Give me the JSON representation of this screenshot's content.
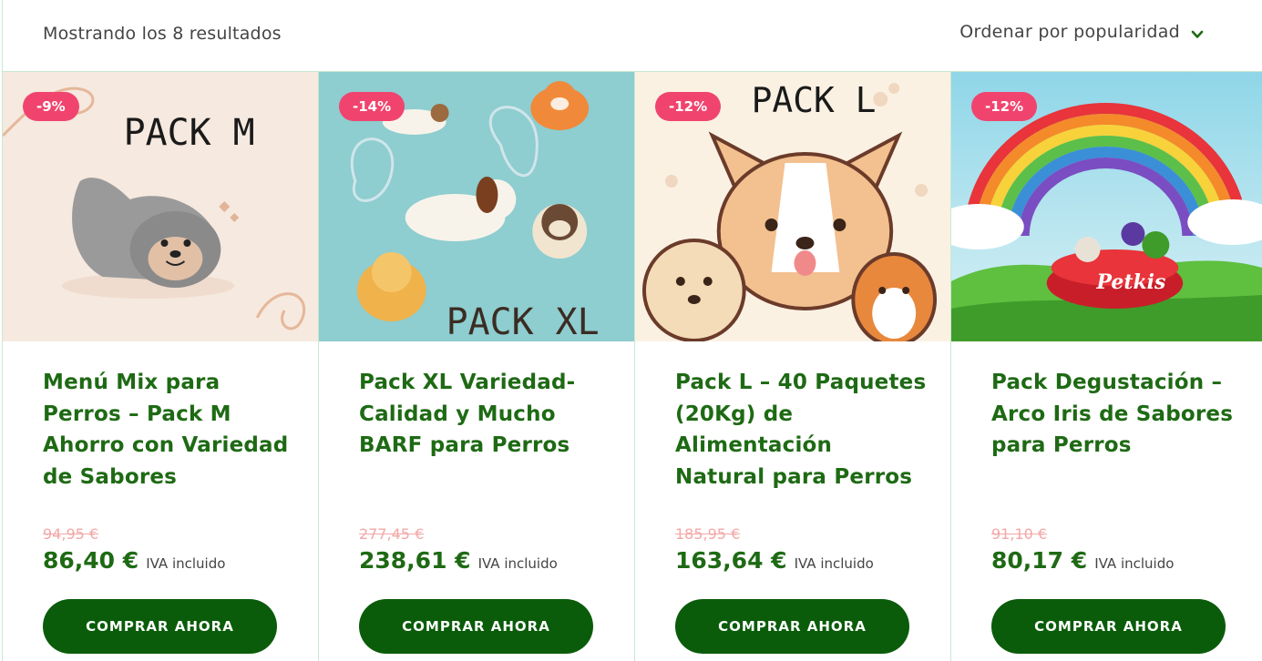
{
  "toolbar": {
    "results_text": "Mostrando los 8 resultados",
    "sort_label": "Ordenar por popularidad"
  },
  "products": [
    {
      "badge": "-9%",
      "image_text": "PACK M",
      "title": "Menú Mix para Perros – Pack M Ahorro con Variedad de Sabores",
      "old_price": "94,95 €",
      "price": "86,40 €",
      "vat": "IVA incluido",
      "button": "COMPRAR AHORA"
    },
    {
      "badge": "-14%",
      "image_text": "PACK XL",
      "title": "Pack XL Variedad- Calidad y Mucho BARF para Perros",
      "old_price": "277,45 €",
      "price": "238,61 €",
      "vat": "IVA incluido",
      "button": "COMPRAR AHORA"
    },
    {
      "badge": "-12%",
      "image_text": "PACK L",
      "title": "Pack L – 40 Paquetes (20Kg) de Alimentación Natural para Perros",
      "old_price": "185,95 €",
      "price": "163,64 €",
      "vat": "IVA incluido",
      "button": "COMPRAR AHORA"
    },
    {
      "badge": "-12%",
      "image_text": "Petkis",
      "title": "Pack Degustación – Arco Iris de Sabores para Perros",
      "old_price": "91,10 €",
      "price": "80,17 €",
      "vat": "IVA incluido",
      "button": "COMPRAR AHORA"
    }
  ],
  "colors": {
    "accent": "#1e6a14",
    "button": "#0a5c0a",
    "badge": "#f0446e",
    "old_price": "#f3a7a7",
    "border": "#c8e9d0"
  },
  "icons": {
    "sort": "chevron-down-icon"
  }
}
